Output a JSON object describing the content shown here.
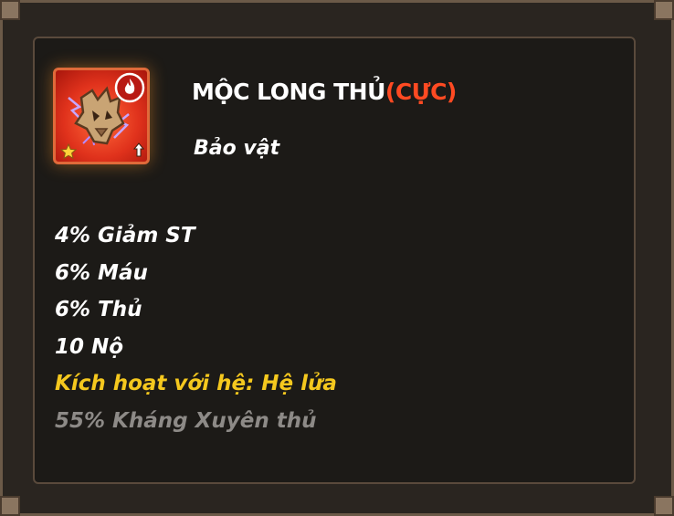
{
  "item": {
    "name": "MỘC LONG THỦ",
    "grade": "(CỰC)",
    "type": "Bảo vật",
    "icon": "dragon-head-lightning-icon",
    "element_badge": "fire-element-icon",
    "rarity_icon": "star-icon",
    "level_icon": "upgrade-arrow-icon"
  },
  "stats": [
    "4% Giảm ST",
    "6% Máu",
    "6% Thủ",
    "10 Nộ"
  ],
  "activation": "Kích hoạt với hệ: Hệ lửa",
  "locked_stat": "55% Kháng Xuyên thủ",
  "colors": {
    "title": "#ffffff",
    "grade": "#ff4a22",
    "stat": "#ffffff",
    "activation": "#f5c81e",
    "locked": "#8d8a87",
    "icon_bg": "#e0321c"
  }
}
